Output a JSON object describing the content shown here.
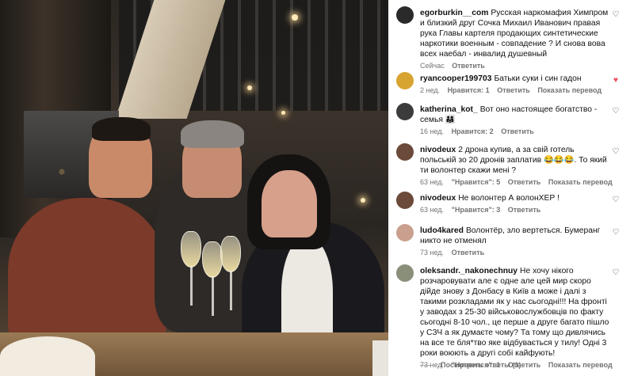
{
  "comments": [
    {
      "username": "egorburkin__com",
      "text": "Русская наркомафия Химпром и близкий друг Сочка Михаил Иванович правая рука Главы картеля продающих синтетические наркотики военным - совпадение ? И снова вова всех наебал - инвалид душевный",
      "time": "Сейчас",
      "likes": "",
      "reply": "Ответить",
      "translate": "",
      "liked": false,
      "avatar_color": "#2a2a2a"
    },
    {
      "username": "ryancooper199703",
      "text": "Батьки суки і син гадон",
      "time": "2 нед.",
      "likes": "Нравится: 1",
      "reply": "Ответить",
      "translate": "Показать перевод",
      "liked": true,
      "avatar_color": "#d7a431"
    },
    {
      "username": "katherina_kot_",
      "text": "Вот оно настоящее богатство - семья 👨‍👩‍👧",
      "time": "16 нед.",
      "likes": "Нравится: 2",
      "reply": "Ответить",
      "translate": "",
      "liked": false,
      "avatar_color": "#3b3b3b"
    },
    {
      "username": "nivodeux",
      "text": "2 дрона купив, а за свій готель польській зо 20 дронів заплатив 😂😂😂. То який ти волонтер скажи мені ?",
      "time": "63 нед.",
      "likes": "\"Нравится\": 5",
      "reply": "Ответить",
      "translate": "Показать перевод",
      "liked": false,
      "avatar_color": "#6b4a3a"
    },
    {
      "username": "nivodeux",
      "text": "Не волонтер А волонХЕР !",
      "time": "63 нед.",
      "likes": "\"Нравится\": 3",
      "reply": "Ответить",
      "translate": "",
      "liked": false,
      "avatar_color": "#6b4a3a"
    },
    {
      "username": "ludo4kared",
      "text": "Волонтёр, зло вертеться. Бумеранг никто не отменял",
      "time": "73 нед.",
      "likes": "",
      "reply": "Ответить",
      "translate": "",
      "liked": false,
      "avatar_color": "#c9a08e"
    },
    {
      "username": "oleksandr._nakonechnuy",
      "text": "Не хочу нікого розчаровувати але є одне але цей мир скоро дійде знову з Донбасу в Київ а може і далі з такими розкладами як у нас сьогодні!!! На фронті у заводах з 25-30 військовослужбовців по факту сьогодні 8-10 чол., це перше а друге багато пішло у СЗЧ а як думаєте чому? Та тому що дивлячись на все те бля*тво яке відбувається у тилу! Одні 3 роки воюють а другі собі кайфують!",
      "time": "73 нед.",
      "likes": "\"Нравится\": 1",
      "reply": "Ответить",
      "translate": "Показать перевод",
      "liked": false,
      "avatar_color": "#8a8f7a"
    }
  ],
  "view_replies": "Посмотреть ответы (1)",
  "icons": {
    "like": "heart-icon",
    "like_filled": "heart-filled-icon"
  }
}
